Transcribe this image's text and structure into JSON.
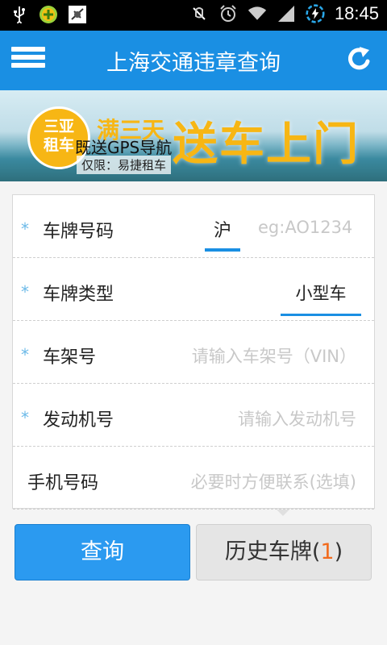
{
  "status_bar": {
    "time": "18:45",
    "icons": [
      "usb-icon",
      "app-plus-icon",
      "debug-icon",
      "vibrate-mute-icon",
      "alarm-icon",
      "wifi-icon",
      "signal-icon",
      "battery-charging-icon"
    ]
  },
  "app_bar": {
    "title": "上海交通违章查询",
    "menu_icon": "hamburger-menu-icon",
    "refresh_icon": "refresh-icon",
    "color": "#1a8fe3"
  },
  "banner": {
    "badge_line1": "三亚",
    "badge_line2": "租车",
    "headline": "满三天",
    "subline": "既送GPS导航",
    "big_text": "送车上门",
    "note": "仅限：易捷租车"
  },
  "form": {
    "plate": {
      "label": "车牌号码",
      "province": "沪",
      "placeholder": "eg:AO1234",
      "required": "*"
    },
    "plate_type": {
      "label": "车牌类型",
      "value": "小型车",
      "required": "*"
    },
    "vin": {
      "label": "车架号",
      "placeholder": "请输入车架号（VIN）",
      "required": "*"
    },
    "engine": {
      "label": "发动机号",
      "placeholder": "请输入发动机号",
      "required": "*"
    },
    "phone": {
      "label": "手机号码",
      "placeholder": "必要时方便联系(选填)"
    }
  },
  "actions": {
    "query_label": "查询",
    "history_label": "历史车牌(",
    "history_count": "1",
    "history_close": ")"
  }
}
